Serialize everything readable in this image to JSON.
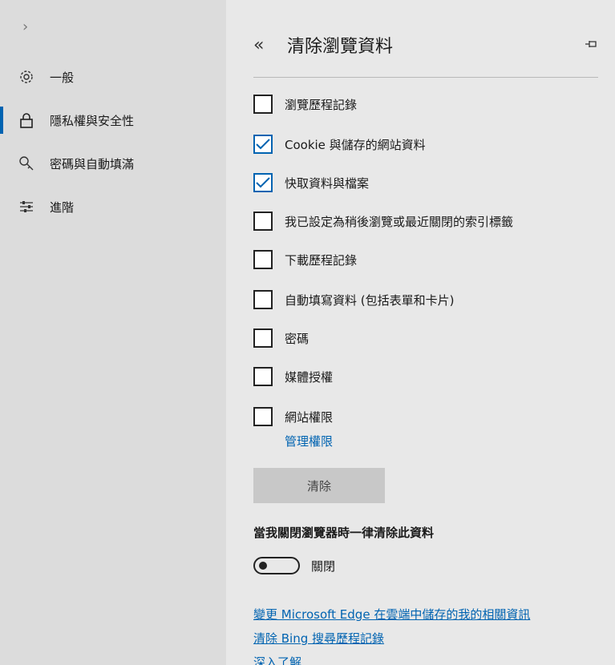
{
  "sidebar": {
    "items": [
      {
        "label": "一般",
        "icon": "gear-icon"
      },
      {
        "label": "隱私權與安全性",
        "icon": "lock-icon",
        "active": true
      },
      {
        "label": "密碼與自動填滿",
        "icon": "key-icon"
      },
      {
        "label": "進階",
        "icon": "sliders-icon"
      }
    ]
  },
  "header": {
    "title": "清除瀏覽資料"
  },
  "options": [
    {
      "label": "瀏覽歷程記錄",
      "checked": false
    },
    {
      "label": "Cookie 與儲存的網站資料",
      "checked": true
    },
    {
      "label": "快取資料與檔案",
      "checked": true
    },
    {
      "label": "我已設定為稍後瀏覽或最近關閉的索引標籤",
      "checked": false
    },
    {
      "label": "下載歷程記錄",
      "checked": false
    },
    {
      "label": "自動填寫資料 (包括表單和卡片)",
      "checked": false
    },
    {
      "label": "密碼",
      "checked": false
    },
    {
      "label": "媒體授權",
      "checked": false
    },
    {
      "label": "網站權限",
      "checked": false
    }
  ],
  "manage_permissions_link": "管理權限",
  "clear_button": "清除",
  "on_close": {
    "heading": "當我關閉瀏覽器時一律清除此資料",
    "toggle_label": "關閉",
    "toggle_on": false
  },
  "footer_links": [
    "變更 Microsoft Edge 在雲端中儲存的我的相關資訊",
    "清除 Bing 搜尋歷程記錄",
    "深入了解"
  ],
  "colors": {
    "accent": "#0063b1",
    "sidebar_bg": "#dcdcdc",
    "main_bg": "#e8e8e8"
  }
}
